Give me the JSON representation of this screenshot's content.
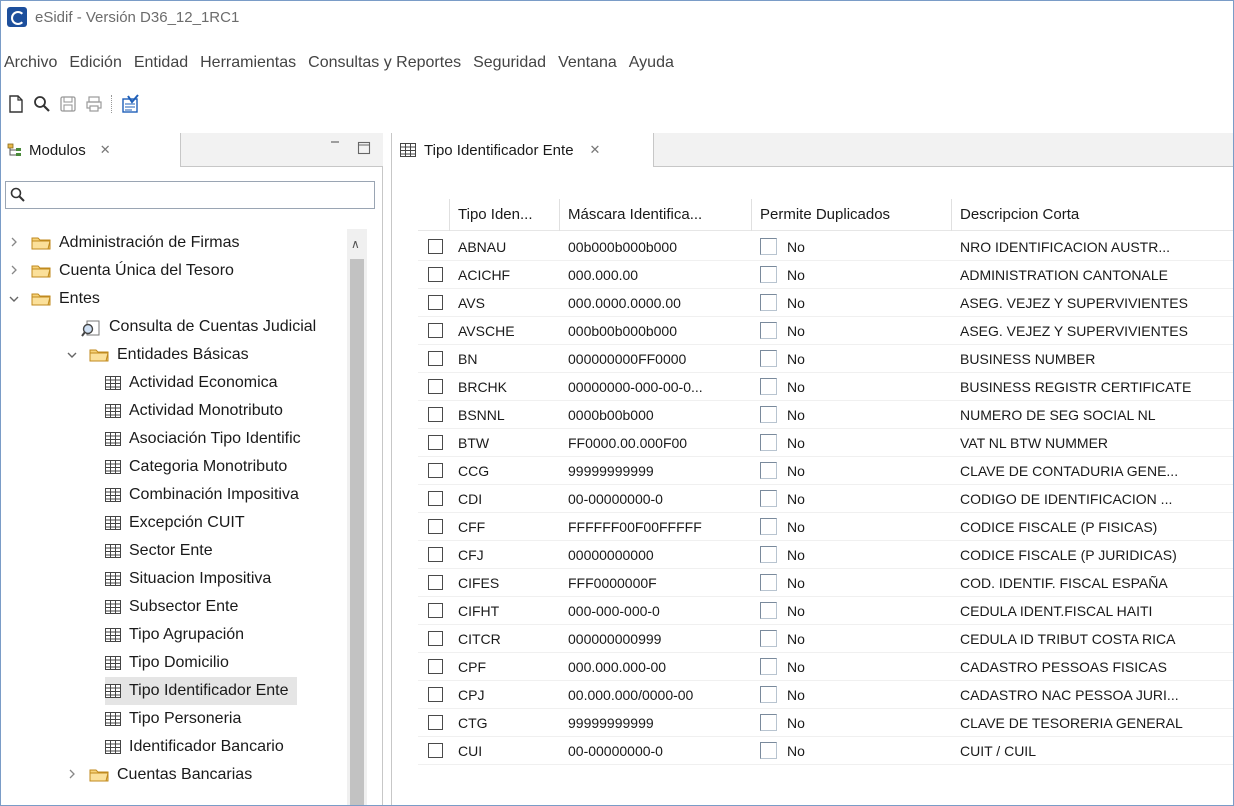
{
  "window": {
    "title": "eSidif - Versión D36_12_1RC1"
  },
  "menu": [
    "Archivo",
    "Edición",
    "Entidad",
    "Herramientas",
    "Consultas y Reportes",
    "Seguridad",
    "Ventana",
    "Ayuda"
  ],
  "left_pane": {
    "tab_label": "Modulos",
    "tree": [
      {
        "label": "Administración de Firmas",
        "level": 0,
        "icon": "folder-icon",
        "caret": "›"
      },
      {
        "label": "Cuenta Única del Tesoro",
        "level": 0,
        "icon": "folder-icon",
        "caret": "›"
      },
      {
        "label": "Entes",
        "level": 0,
        "icon": "folder-icon",
        "caret": "⌄"
      },
      {
        "label": "Consulta de Cuentas Judicial",
        "level": 1,
        "icon": "search-doc-icon",
        "caret": ""
      },
      {
        "label": "Entidades Básicas",
        "level": 1,
        "icon": "folder-icon",
        "caret": "⌄"
      },
      {
        "label": "Actividad Economica",
        "level": 2,
        "icon": "grid-icon",
        "caret": ""
      },
      {
        "label": "Actividad Monotributo",
        "level": 2,
        "icon": "grid-icon",
        "caret": ""
      },
      {
        "label": "Asociación Tipo Identific",
        "level": 2,
        "icon": "grid-icon",
        "caret": ""
      },
      {
        "label": "Categoria Monotributo",
        "level": 2,
        "icon": "grid-icon",
        "caret": ""
      },
      {
        "label": "Combinación Impositiva",
        "level": 2,
        "icon": "grid-icon",
        "caret": ""
      },
      {
        "label": "Excepción CUIT",
        "level": 2,
        "icon": "grid-icon",
        "caret": ""
      },
      {
        "label": "Sector Ente",
        "level": 2,
        "icon": "grid-icon",
        "caret": ""
      },
      {
        "label": "Situacion Impositiva",
        "level": 2,
        "icon": "grid-icon",
        "caret": ""
      },
      {
        "label": "Subsector Ente",
        "level": 2,
        "icon": "grid-icon",
        "caret": ""
      },
      {
        "label": "Tipo Agrupación",
        "level": 2,
        "icon": "grid-icon",
        "caret": ""
      },
      {
        "label": "Tipo Domicilio",
        "level": 2,
        "icon": "grid-icon",
        "caret": ""
      },
      {
        "label": "Tipo Identificador Ente",
        "level": 2,
        "icon": "grid-icon",
        "caret": "",
        "selected": true
      },
      {
        "label": "Tipo Personeria",
        "level": 2,
        "icon": "grid-icon",
        "caret": ""
      },
      {
        "label": "Identificador Bancario",
        "level": 2,
        "icon": "grid-icon",
        "caret": ""
      },
      {
        "label": "Cuentas Bancarias",
        "level": 1,
        "icon": "folder-icon",
        "caret": "›"
      }
    ]
  },
  "right_pane": {
    "tab_label": "Tipo Identificador Ente",
    "columns": [
      "Tipo Iden...",
      "Máscara Identifica...",
      "Permite Duplicados",
      "Descripcion Corta"
    ],
    "rows": [
      [
        "ABNAU",
        "00b000b000b000",
        "No",
        "NRO IDENTIFICACION AUSTR..."
      ],
      [
        "ACICHF",
        "000.000.00",
        "No",
        "ADMINISTRATION CANTONALE"
      ],
      [
        "AVS",
        "000.0000.0000.00",
        "No",
        "ASEG. VEJEZ Y SUPERVIVIENTES"
      ],
      [
        "AVSCHE",
        "000b00b000b000",
        "No",
        "ASEG. VEJEZ Y SUPERVIVIENTES"
      ],
      [
        "BN",
        "000000000FF0000",
        "No",
        "BUSINESS NUMBER"
      ],
      [
        "BRCHK",
        "00000000-000-00-0...",
        "No",
        "BUSINESS REGISTR CERTIFICATE"
      ],
      [
        "BSNNL",
        "0000b00b000",
        "No",
        "NUMERO DE SEG SOCIAL NL"
      ],
      [
        "BTW",
        "FF0000.00.000F00",
        "No",
        "VAT NL BTW NUMMER"
      ],
      [
        "CCG",
        "99999999999",
        "No",
        "CLAVE DE CONTADURIA GENE..."
      ],
      [
        "CDI",
        "00-00000000-0",
        "No",
        "CODIGO DE IDENTIFICACION ..."
      ],
      [
        "CFF",
        "FFFFFF00F00FFFFF",
        "No",
        "CODICE FISCALE (P FISICAS)"
      ],
      [
        "CFJ",
        "00000000000",
        "No",
        "CODICE FISCALE (P JURIDICAS)"
      ],
      [
        "CIFES",
        "FFF0000000F",
        "No",
        "COD. IDENTIF. FISCAL ESPAÑA"
      ],
      [
        "CIFHT",
        "000-000-000-0",
        "No",
        "CEDULA IDENT.FISCAL HAITI"
      ],
      [
        "CITCR",
        "000000000999",
        "No",
        "CEDULA ID TRIBUT COSTA RICA"
      ],
      [
        "CPF",
        "000.000.000-00",
        "No",
        "CADASTRO PESSOAS FISICAS"
      ],
      [
        "CPJ",
        "00.000.000/0000-00",
        "No",
        "CADASTRO NAC PESSOA JURI..."
      ],
      [
        "CTG",
        "99999999999",
        "No",
        "CLAVE DE TESORERIA GENERAL"
      ],
      [
        "CUI",
        "00-00000000-0",
        "No",
        "CUIT / CUIL"
      ]
    ]
  },
  "colors": {
    "folder": "#e8b84a",
    "selection": "#e5e5e5",
    "border": "#7a9cc7"
  }
}
